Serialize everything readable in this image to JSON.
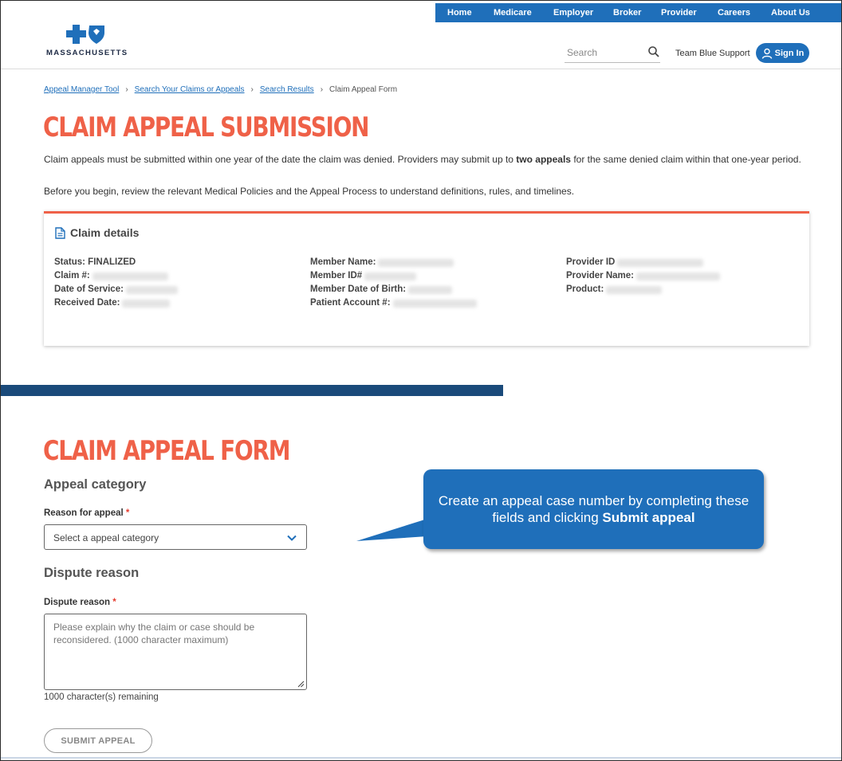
{
  "topnav": {
    "items": [
      {
        "label": "Home"
      },
      {
        "label": "Medicare"
      },
      {
        "label": "Employer"
      },
      {
        "label": "Broker"
      },
      {
        "label": "Provider"
      },
      {
        "label": "Careers"
      },
      {
        "label": "About Us"
      }
    ],
    "color": "#1f6fba"
  },
  "header": {
    "logo_text": "MASSACHUSETTS",
    "search_placeholder": "Search",
    "team_support": "Team Blue Support",
    "signin_label": "Sign In"
  },
  "breadcrumb": [
    {
      "label": "Appeal Manager Tool"
    },
    {
      "label": "Search Your Claims or Appeals"
    },
    {
      "label": "Search Results"
    },
    {
      "label": "Claim Appeal Form"
    }
  ],
  "page": {
    "title": "CLAIM APPEAL SUBMISSION",
    "intro_part1": "Claim appeals must be submitted within one year of the date the claim was denied. Providers may submit up to ",
    "intro_bold": "two appeals",
    "intro_part2": " for the same denied claim within that one-year period.",
    "intro_line2": "Before you begin, review the relevant Medical Policies and the Appeal Process to understand definitions, rules, and timelines."
  },
  "claim_details": {
    "title": "Claim details",
    "col1": [
      {
        "label": "Status: FINALIZED"
      },
      {
        "label": "Claim #:"
      },
      {
        "label": "Date of Service:"
      },
      {
        "label": "Received Date:"
      }
    ],
    "col2": [
      {
        "label": "Member Name:"
      },
      {
        "label": "Member ID#"
      },
      {
        "label": "Member Date of Birth:"
      },
      {
        "label": "Patient Account #:"
      }
    ],
    "col3": [
      {
        "label": "Provider ID"
      },
      {
        "label": "Provider Name:"
      },
      {
        "label": "Product:"
      }
    ]
  },
  "form": {
    "title": "CLAIM APPEAL FORM",
    "appeal_category_heading": "Appeal category",
    "reason_label": "Reason for appeal",
    "required_mark": "*",
    "reason_select_value": "Select a appeal category",
    "dispute_heading": "Dispute reason",
    "dispute_label": "Dispute reason",
    "dispute_placeholder": "Please explain why the claim or case should be reconsidered. (1000 character maximum)",
    "remaining_text": "1000 character(s) remaining",
    "submit_label": "SUBMIT APPEAL"
  },
  "callout": {
    "text_part1": "Create an appeal case number by completing these fields and clicking ",
    "text_bold": "Submit appeal"
  },
  "colors": {
    "accent_orange": "#ef6148",
    "brand_blue": "#1f6fba",
    "navy_bar": "#1a4a7a"
  }
}
